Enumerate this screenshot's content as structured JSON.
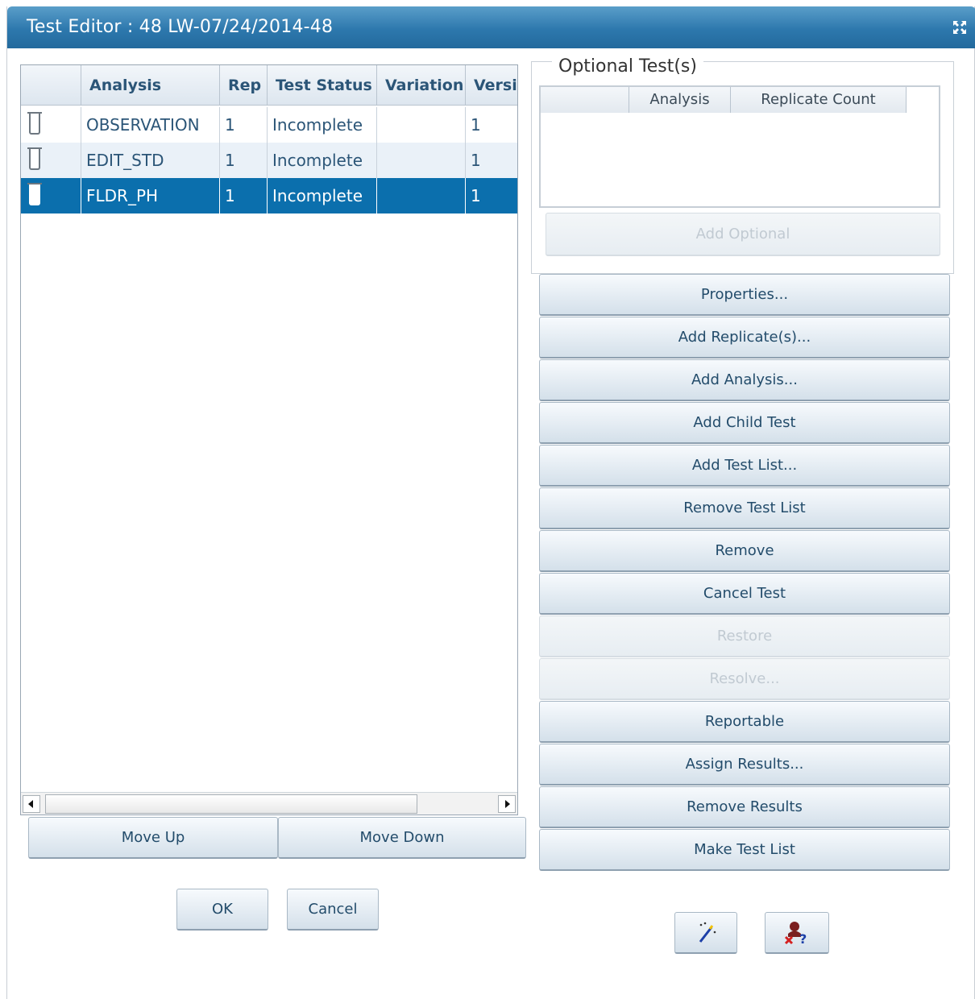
{
  "window": {
    "title": "Test Editor : 48 LW-07/24/2014-48"
  },
  "grid": {
    "columns": [
      "",
      "Analysis",
      "Rep",
      "Test Status",
      "Variation",
      "Versi"
    ],
    "rows": [
      {
        "analysis": "OBSERVATION",
        "rep": "1",
        "status": "Incomplete",
        "variation": "",
        "version": "1",
        "selected": false
      },
      {
        "analysis": "EDIT_STD",
        "rep": "1",
        "status": "Incomplete",
        "variation": "",
        "version": "1",
        "selected": false
      },
      {
        "analysis": "FLDR_PH",
        "rep": "1",
        "status": "Incomplete",
        "variation": "",
        "version": "1",
        "selected": true
      }
    ]
  },
  "move": {
    "up": "Move Up",
    "down": "Move Down"
  },
  "dialog_buttons": {
    "ok": "OK",
    "cancel": "Cancel"
  },
  "optional": {
    "legend": "Optional Test(s)",
    "columns": [
      "",
      "Analysis",
      "Replicate Count"
    ],
    "add_optional": "Add Optional"
  },
  "actions": {
    "properties": "Properties...",
    "add_replicates": "Add Replicate(s)...",
    "add_analysis": "Add Analysis...",
    "add_child_test": "Add Child Test",
    "add_test_list": "Add Test List...",
    "remove_test_list": "Remove Test List",
    "remove": "Remove",
    "cancel_test": "Cancel Test",
    "restore": "Restore",
    "resolve": "Resolve...",
    "reportable": "Reportable",
    "assign_results": "Assign Results...",
    "remove_results": "Remove Results",
    "make_test_list": "Make Test List"
  },
  "tools": {
    "wand_icon": "magic-wand-icon",
    "help_icon": "context-help-icon"
  },
  "colors": {
    "title_bar": "#2d78ad",
    "selection": "#0b6fad",
    "header_text": "#2b5577"
  }
}
